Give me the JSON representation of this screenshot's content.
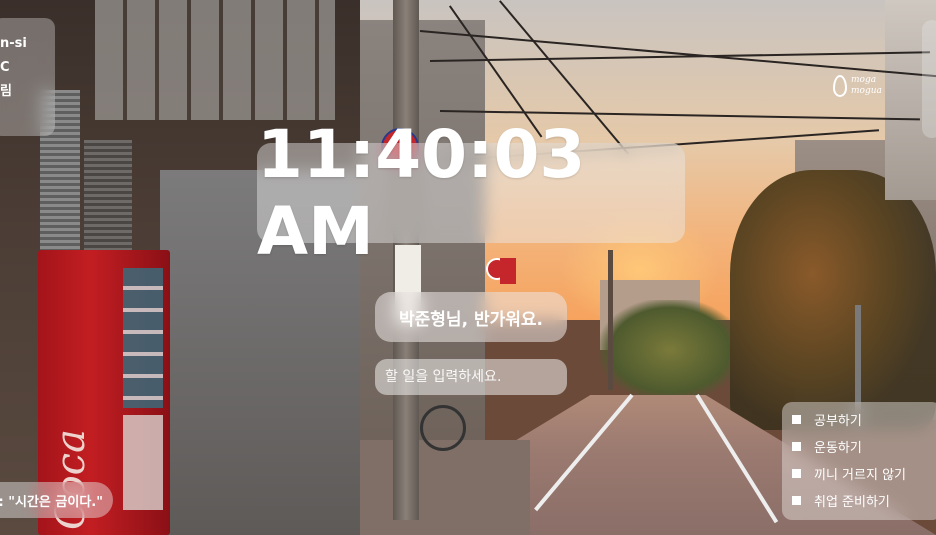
{
  "weather": {
    "location": "n-si",
    "temperature": "C",
    "condition": "림"
  },
  "clock": {
    "time": "11:40:03 AM"
  },
  "greeting": {
    "text": "박준형님, 반가워요."
  },
  "task_input": {
    "placeholder": "할 일을 입력하세요.",
    "value": ""
  },
  "quote": {
    "text": ": \"시간은 금이다.\""
  },
  "todos": {
    "items": [
      {
        "label": "공부하기"
      },
      {
        "label": "운동하기"
      },
      {
        "label": "끼니 거르지 않기"
      },
      {
        "label": "취업 준비하기"
      }
    ]
  },
  "logo": {
    "line1": "moga",
    "line2": "mogua"
  },
  "colors": {
    "overlay": "#ffffff",
    "text": "#ffffff"
  }
}
